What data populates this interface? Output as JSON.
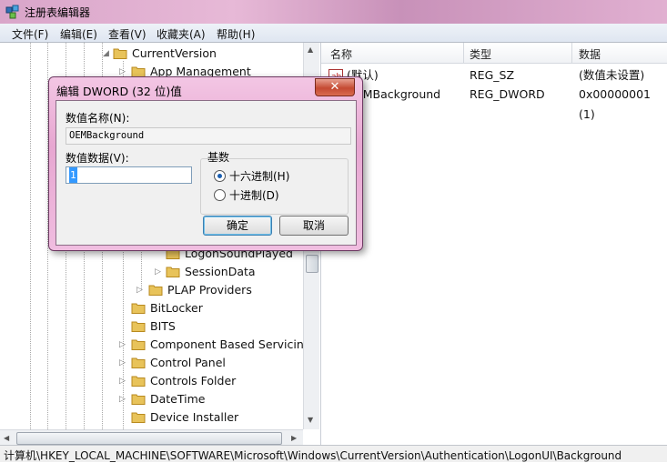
{
  "window": {
    "title": "注册表编辑器",
    "icon": "registry-editor-icon"
  },
  "menu": [
    "文件(F)",
    "编辑(E)",
    "查看(V)",
    "收藏夹(A)",
    "帮助(H)"
  ],
  "tree": {
    "items": [
      {
        "label": "CurrentVersion",
        "expander": "◢"
      },
      {
        "label": "App Management",
        "expander": "▷"
      },
      {
        "label": "LogonSoundPlayed",
        "expander": ""
      },
      {
        "label": "SessionData",
        "expander": "▷"
      },
      {
        "label": "PLAP Providers",
        "expander": "▷"
      },
      {
        "label": "BitLocker",
        "expander": ""
      },
      {
        "label": "BITS",
        "expander": ""
      },
      {
        "label": "Component Based Servicing",
        "expander": "▷"
      },
      {
        "label": "Control Panel",
        "expander": "▷"
      },
      {
        "label": "Controls Folder",
        "expander": "▷"
      },
      {
        "label": "DateTime",
        "expander": "▷"
      },
      {
        "label": "Device Installer",
        "expander": ""
      }
    ]
  },
  "list": {
    "headers": [
      "名称",
      "类型",
      "数据"
    ],
    "rows": [
      {
        "name": "(默认)",
        "type": "REG_SZ",
        "data": "(数值未设置)"
      },
      {
        "name": "OEMBackground",
        "type": "REG_DWORD",
        "data": "0x00000001 (1)"
      }
    ]
  },
  "status": "计算机\\HKEY_LOCAL_MACHINE\\SOFTWARE\\Microsoft\\Windows\\CurrentVersion\\Authentication\\LogonUI\\Background",
  "dialog": {
    "title": "编辑 DWORD (32 位)值",
    "close_label": "✕",
    "name_label": "数值名称(N):",
    "name_value": "OEMBackground",
    "data_label": "数值数据(V):",
    "data_value": "1",
    "base_label": "基数",
    "hex_label": "十六进制(H)",
    "dec_label": "十进制(D)",
    "selected_base": "hex",
    "ok_label": "确定",
    "cancel_label": "取消"
  }
}
